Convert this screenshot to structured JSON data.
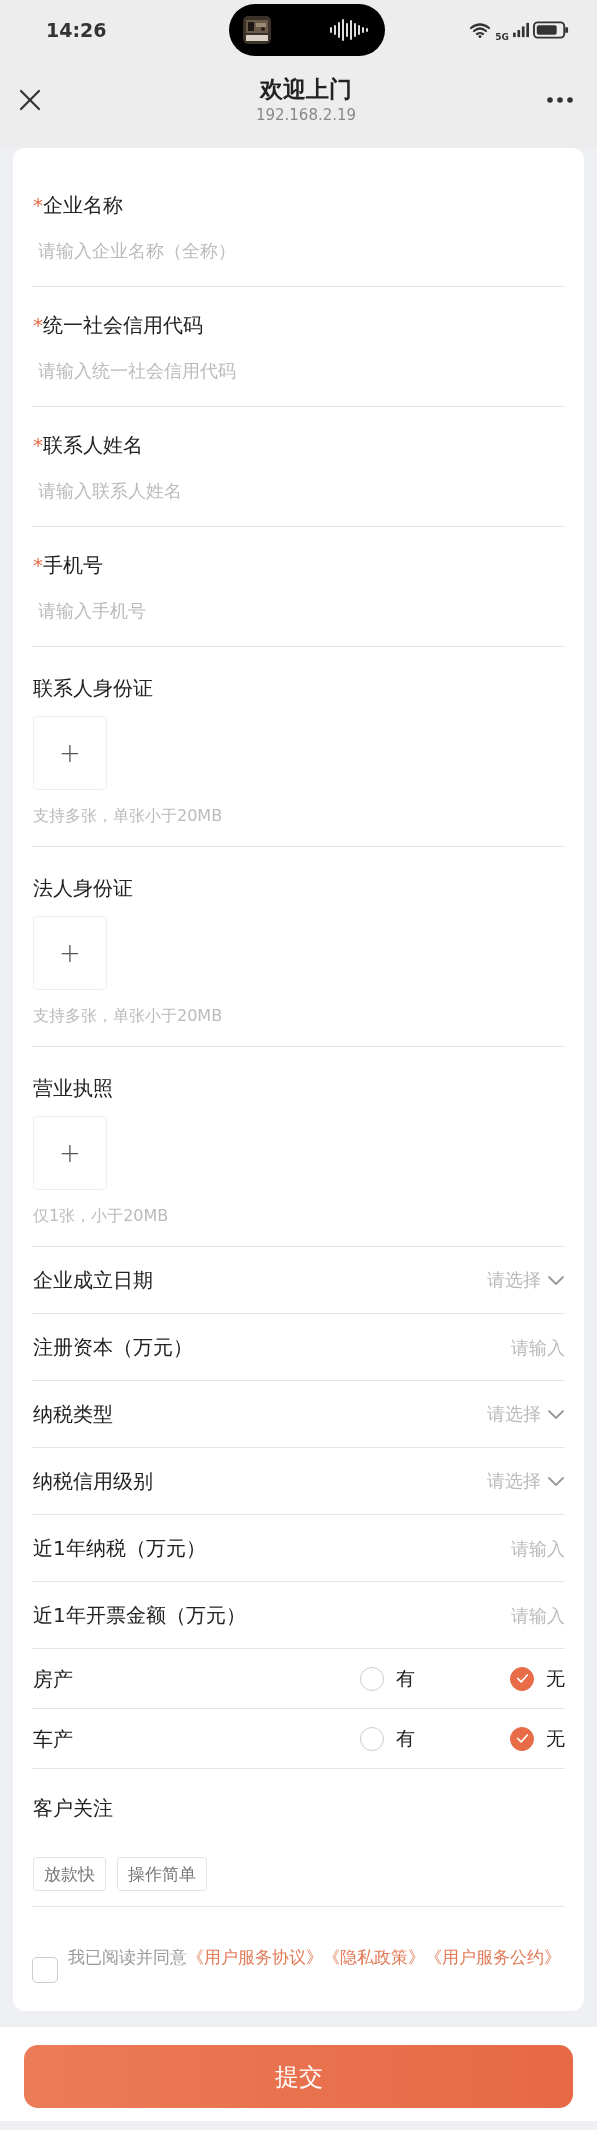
{
  "status_bar": {
    "time": "14:26",
    "network": "5G"
  },
  "nav": {
    "title": "欢迎上门",
    "subtitle": "192.168.2.19"
  },
  "fields": [
    {
      "kind": "text",
      "required_mark": "*",
      "label": "企业名称",
      "placeholder": "请输入企业名称（全称）"
    },
    {
      "kind": "text",
      "required_mark": "*",
      "label": "统一社会信用代码",
      "placeholder": "请输入统一社会信用代码"
    },
    {
      "kind": "text",
      "required_mark": "*",
      "label": "联系人姓名",
      "placeholder": "请输入联系人姓名"
    },
    {
      "kind": "text",
      "required_mark": "*",
      "label": "手机号",
      "placeholder": "请输入手机号"
    },
    {
      "kind": "upload",
      "label": "联系人身份证",
      "add": "+",
      "hint": "支持多张，单张小于20MB"
    },
    {
      "kind": "upload",
      "label": "法人身份证",
      "add": "+",
      "hint": "支持多张，单张小于20MB"
    },
    {
      "kind": "upload",
      "label": "营业执照",
      "add": "+",
      "hint": "仅1张，小于20MB"
    },
    {
      "kind": "select",
      "label": "企业成立日期",
      "placeholder": "请选择"
    },
    {
      "kind": "input",
      "label": "注册资本（万元）",
      "placeholder": "请输入"
    },
    {
      "kind": "select",
      "label": "纳税类型",
      "placeholder": "请选择"
    },
    {
      "kind": "select",
      "label": "纳税信用级别",
      "placeholder": "请选择"
    },
    {
      "kind": "input",
      "label": "近1年纳税（万元）",
      "placeholder": "请输入"
    },
    {
      "kind": "input",
      "label": "近1年开票金额（万元）",
      "placeholder": "请输入"
    },
    {
      "kind": "radio",
      "label": "房产",
      "options": [
        {
          "label": "有",
          "selected": false
        },
        {
          "label": "无",
          "selected": true
        }
      ]
    },
    {
      "kind": "radio",
      "label": "车产",
      "options": [
        {
          "label": "有",
          "selected": false
        },
        {
          "label": "无",
          "selected": true
        }
      ]
    },
    {
      "kind": "tags",
      "label": "客户关注",
      "tags": [
        "放款快",
        "操作简单"
      ]
    }
  ],
  "agreement": {
    "checked": false,
    "text": "我已阅读并同意",
    "links": [
      "《用户服务协议》",
      "《隐私政策》",
      "《用户服务公约》"
    ]
  },
  "submit_button": "提交"
}
